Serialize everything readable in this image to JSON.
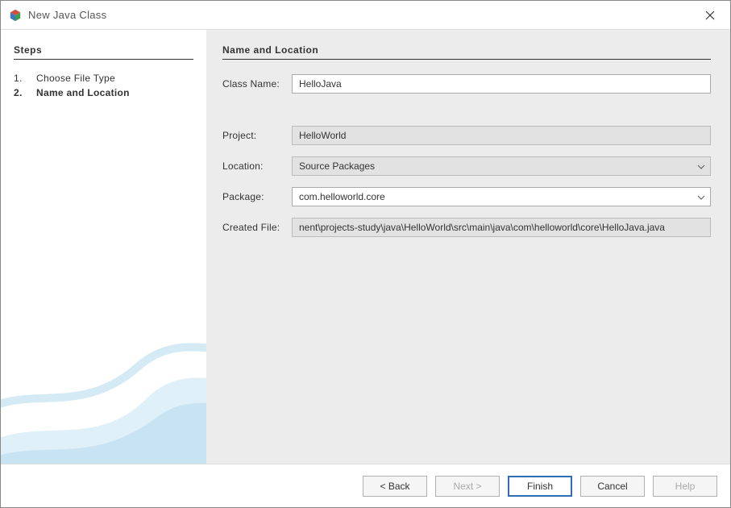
{
  "window": {
    "title": "New Java Class"
  },
  "sidebar": {
    "heading": "Steps",
    "steps": [
      {
        "num": "1.",
        "label": "Choose File Type",
        "current": false
      },
      {
        "num": "2.",
        "label": "Name and Location",
        "current": true
      }
    ]
  },
  "main": {
    "heading": "Name and Location",
    "fields": {
      "className": {
        "label": "Class Name:",
        "value": "HelloJava"
      },
      "project": {
        "label": "Project:",
        "value": "HelloWorld"
      },
      "location": {
        "label": "Location:",
        "value": "Source Packages"
      },
      "package": {
        "label": "Package:",
        "value": "com.helloworld.core"
      },
      "createdFile": {
        "label": "Created File:",
        "value": "nent\\projects-study\\java\\HelloWorld\\src\\main\\java\\com\\helloworld\\core\\HelloJava.java"
      }
    }
  },
  "footer": {
    "back": "< Back",
    "next": "Next >",
    "finish": "Finish",
    "cancel": "Cancel",
    "help": "Help"
  }
}
